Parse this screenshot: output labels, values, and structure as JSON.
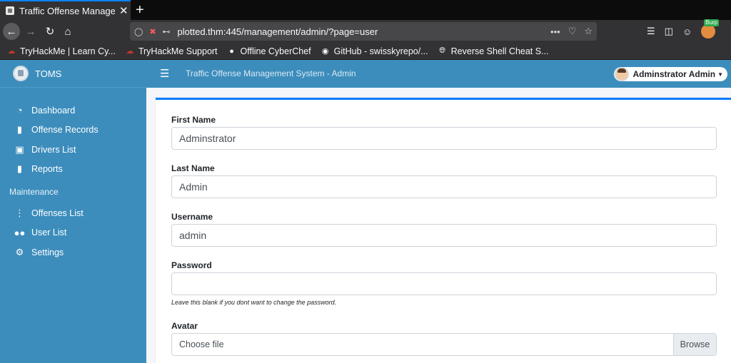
{
  "browser": {
    "tab_title": "Traffic Offense Managem",
    "tab_close": "✕",
    "new_tab": "+",
    "url": "plotted.thm:445/management/admin/?page=user",
    "url_more": "•••",
    "burp_label": "Burp",
    "bookmarks": [
      {
        "label": "TryHackMe | Learn Cy...",
        "icon": "tryhackme-icon"
      },
      {
        "label": "TryHackMe Support",
        "icon": "tryhackme-icon"
      },
      {
        "label": "Offline CyberChef",
        "icon": "chef-hat-icon"
      },
      {
        "label": "GitHub - swisskyrepo/...",
        "icon": "github-icon"
      },
      {
        "label": "Reverse Shell Cheat S...",
        "icon": "globe-icon"
      }
    ]
  },
  "app": {
    "brand": "TOMS",
    "system_title": "Traffic Offense Management System - Admin",
    "user_name": "Adminstrator Admin",
    "menu": [
      {
        "label": "Dashboard",
        "icon": "dashboard-icon"
      },
      {
        "label": "Offense Records",
        "icon": "file-icon"
      },
      {
        "label": "Drivers List",
        "icon": "id-card-icon"
      },
      {
        "label": "Reports",
        "icon": "report-icon"
      }
    ],
    "maintenance_header": "Maintenance",
    "maintenance_menu": [
      {
        "label": "Offenses List",
        "icon": "traffic-light-icon"
      },
      {
        "label": "User List",
        "icon": "users-icon"
      },
      {
        "label": "Settings",
        "icon": "gears-icon"
      }
    ]
  },
  "form": {
    "first_name_label": "First Name",
    "first_name_value": "Adminstrator",
    "last_name_label": "Last Name",
    "last_name_value": "Admin",
    "username_label": "Username",
    "username_value": "admin",
    "password_label": "Password",
    "password_value": "",
    "password_hint": "Leave this blank if you dont want to change the password.",
    "avatar_label": "Avatar",
    "avatar_placeholder": "Choose file",
    "browse_label": "Browse"
  }
}
